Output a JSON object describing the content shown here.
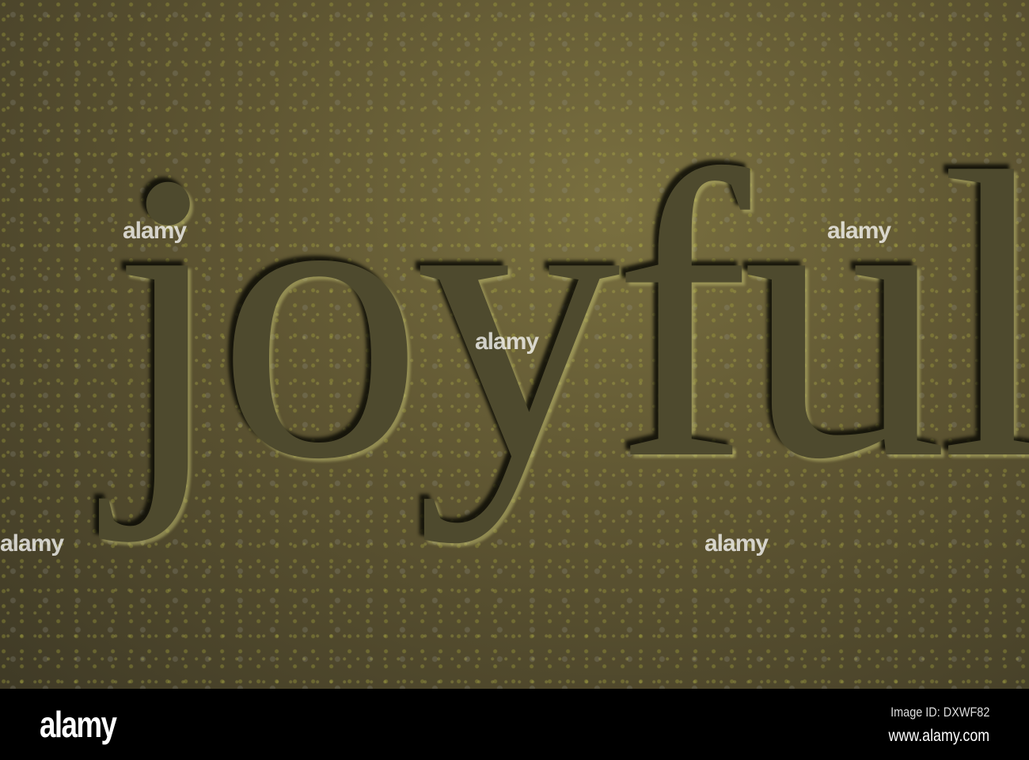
{
  "photo": {
    "carved_word": "joyful"
  },
  "watermark": {
    "text": "alamy"
  },
  "footer": {
    "logo": "alamy",
    "image_id": "Image ID: DXWF82",
    "url": "www.alamy.com"
  }
}
